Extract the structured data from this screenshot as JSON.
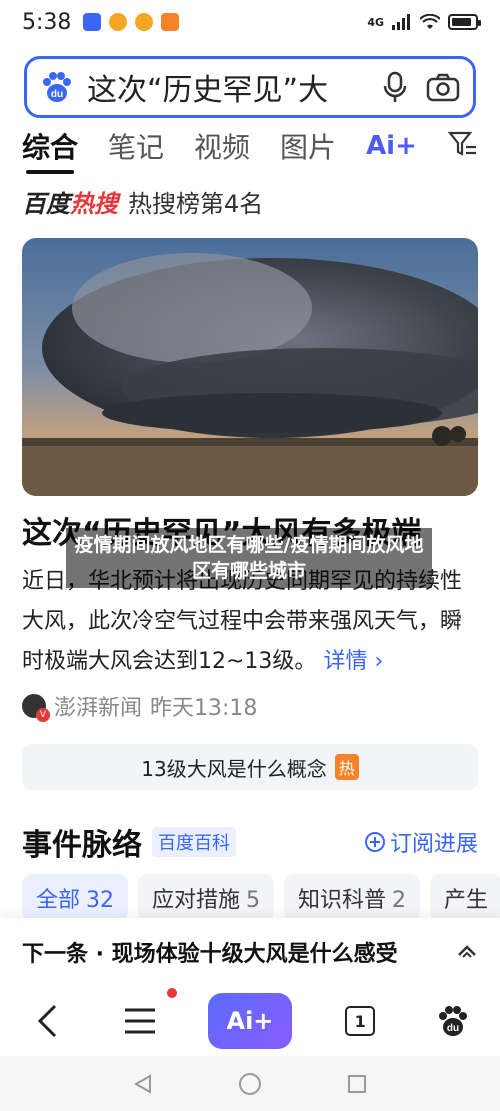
{
  "status_bar": {
    "time": "5:38",
    "network": "4G",
    "battery_level": 0.85
  },
  "search": {
    "query": "这次“历史罕见”大"
  },
  "tabs": [
    {
      "label": "综合",
      "active": true
    },
    {
      "label": "笔记",
      "active": false
    },
    {
      "label": "视频",
      "active": false
    },
    {
      "label": "图片",
      "active": false
    }
  ],
  "ai_tab_label": "Ai+",
  "hot": {
    "brand_main": "百度",
    "brand_accent": "热搜",
    "rank_text": "热搜榜第4名"
  },
  "article": {
    "headline": "这次“历史罕见”大风有多极端",
    "summary": "近日，华北预计将出现历史同期罕见的持续性大风，此次冷空气过程中会带来强风天气，瞬时极端大风会达到12~13级。",
    "more_label": "详情",
    "overlay_title": "疫情期间放风地区有哪些/疫情期间放风地区有哪些城市",
    "source_name": "澎湃新闻",
    "source_time": "昨天13:18"
  },
  "related": {
    "query": "13级大风是什么概念",
    "badge": "热"
  },
  "events": {
    "title": "事件脉络",
    "tag": "百度百科",
    "subscribe_label": "订阅进展",
    "chips": [
      {
        "label": "全部",
        "count": "32",
        "active": true
      },
      {
        "label": "应对措施",
        "count": "5",
        "active": false
      },
      {
        "label": "知识科普",
        "count": "2",
        "active": false
      },
      {
        "label": "产生",
        "count": "",
        "active": false
      }
    ]
  },
  "next": {
    "text": "下一条 · 现场体验十级大风是什么感受"
  },
  "bottom_nav": {
    "ai_label": "Ai+",
    "tab_count": "1"
  },
  "colors": {
    "accent": "#3b66f5",
    "hot_red": "#e8373b",
    "hot_badge": "#f5832a"
  }
}
